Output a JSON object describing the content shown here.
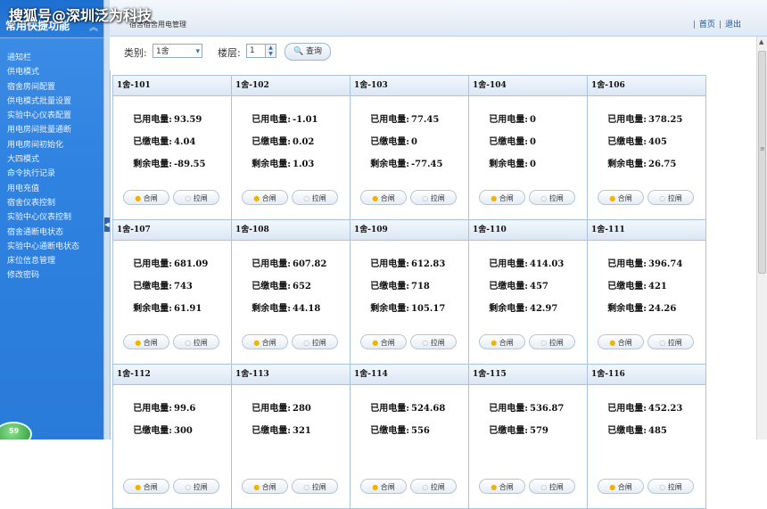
{
  "watermark": "搜狐号@深圳泛为科技",
  "sidebar": {
    "title": "常用快捷功能",
    "collapse_icon": "double-chevron-up-icon",
    "items": [
      "通知栏",
      "供电模式",
      "宿舍房间配置",
      "供电模式批量设置",
      "实验中心仪表配置",
      "用电房间批量通断",
      "用电房间初始化",
      "大四模式",
      "命令执行记录",
      "用电充值",
      "宿舍仪表控制",
      "实验中心仪表控制",
      "宿舍通断电状态",
      "实验中心通断电状态",
      "床位信息管理",
      "修改密码"
    ],
    "globe_label": "59"
  },
  "topbar": {
    "breadcrumb": "宿舍宿舍用电管理",
    "home": "首页",
    "logout": "退出"
  },
  "filter": {
    "category_label": "类别:",
    "category_value": "1舍",
    "floor_label": "楼层:",
    "floor_value": "1",
    "query_label": "查询"
  },
  "labels": {
    "used": "已用电量:",
    "paid": "已缴电量:",
    "remaining": "剩余电量:",
    "on": "合闸",
    "off": "拉闸"
  },
  "rooms": [
    {
      "name": "1舍-101",
      "used": "93.59",
      "paid": "4.04",
      "remaining": "-89.55"
    },
    {
      "name": "1舍-102",
      "used": "-1.01",
      "paid": "0.02",
      "remaining": "1.03"
    },
    {
      "name": "1舍-103",
      "used": "77.45",
      "paid": "0",
      "remaining": "-77.45"
    },
    {
      "name": "1舍-104",
      "used": "0",
      "paid": "0",
      "remaining": "0"
    },
    {
      "name": "1舍-106",
      "used": "378.25",
      "paid": "405",
      "remaining": "26.75"
    },
    {
      "name": "1舍-107",
      "used": "681.09",
      "paid": "743",
      "remaining": "61.91"
    },
    {
      "name": "1舍-108",
      "used": "607.82",
      "paid": "652",
      "remaining": "44.18"
    },
    {
      "name": "1舍-109",
      "used": "612.83",
      "paid": "718",
      "remaining": "105.17"
    },
    {
      "name": "1舍-110",
      "used": "414.03",
      "paid": "457",
      "remaining": "42.97"
    },
    {
      "name": "1舍-111",
      "used": "396.74",
      "paid": "421",
      "remaining": "24.26"
    },
    {
      "name": "1舍-112",
      "used": "99.6",
      "paid": "300",
      "remaining": ""
    },
    {
      "name": "1舍-113",
      "used": "280",
      "paid": "321",
      "remaining": ""
    },
    {
      "name": "1舍-114",
      "used": "524.68",
      "paid": "556",
      "remaining": ""
    },
    {
      "name": "1舍-115",
      "used": "536.87",
      "paid": "579",
      "remaining": ""
    },
    {
      "name": "1舍-116",
      "used": "452.23",
      "paid": "485",
      "remaining": ""
    }
  ]
}
